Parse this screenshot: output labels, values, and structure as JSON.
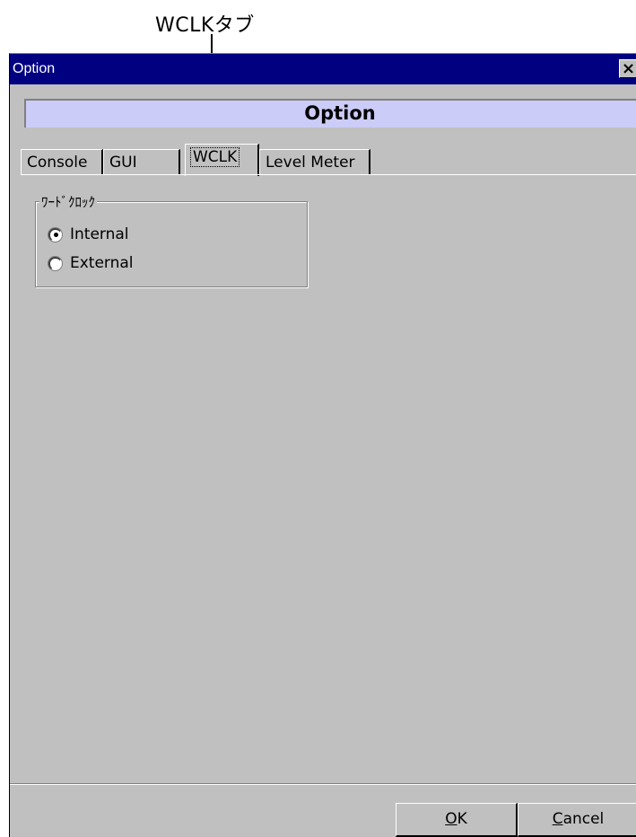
{
  "annotation": {
    "label": "WCLKタブ"
  },
  "window": {
    "title": "Option",
    "close_glyph": "✕",
    "header": "Option"
  },
  "tabs": [
    {
      "label": "Console",
      "active": false
    },
    {
      "label": "GUI",
      "active": false
    },
    {
      "label": "WCLK",
      "active": true
    },
    {
      "label": "Level Meter",
      "active": false
    }
  ],
  "wordclock_group": {
    "legend": "ﾜｰﾄﾞｸﾛｯｸ",
    "options": [
      {
        "label": "Internal",
        "selected": true
      },
      {
        "label": "External",
        "selected": false
      }
    ]
  },
  "buttons": {
    "ok": {
      "accel": "O",
      "rest": "K"
    },
    "cancel": {
      "accel": "C",
      "rest": "ancel"
    }
  },
  "colors": {
    "titlebar": "#000080",
    "header_band": "#ccccf8",
    "face": "#c0c0c0"
  }
}
